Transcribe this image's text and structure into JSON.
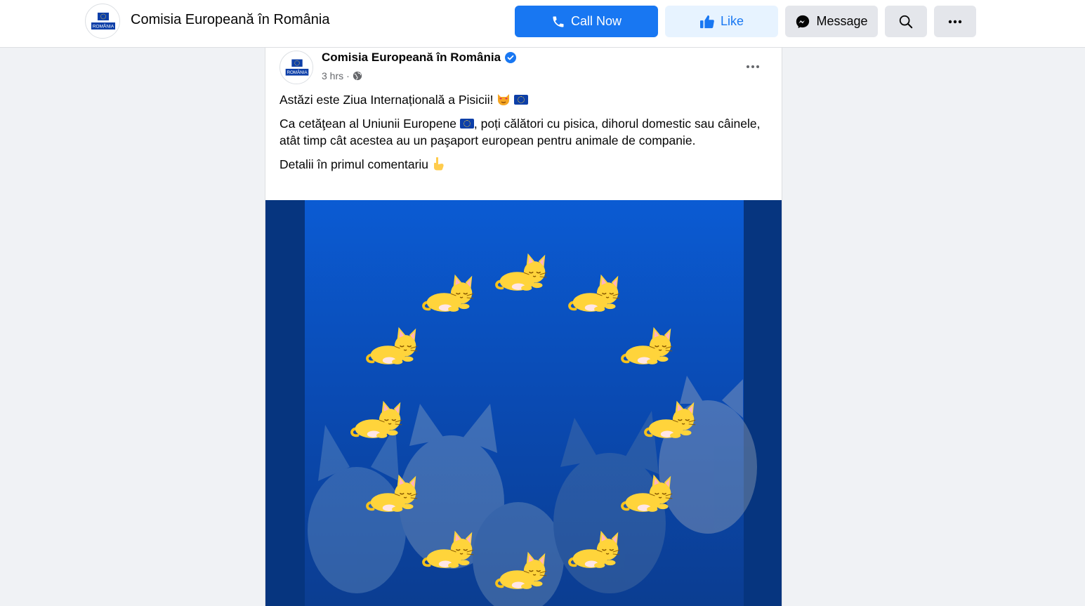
{
  "header": {
    "page_name": "Comisia Europeană în România",
    "avatar_label": "ROMÂNIA",
    "call_label": "Call Now",
    "like_label": "Like",
    "message_label": "Message"
  },
  "post": {
    "author": "Comisia Europeană în România",
    "time": "3 hrs",
    "line1": "Astăzi este Ziua Internațională a Pisicii!",
    "line2a": "Ca cetăţean al Uniunii Europene",
    "line2b": ", poți călători cu pisica, dihorul domestic sau câinele, atât timp cât acestea au un paşaport european pentru animale de companie.",
    "line3": "Detalii în primul comentariu"
  },
  "colors": {
    "primary": "#1877f2",
    "image_blue": "#0a4cc4",
    "star_yellow": "#ffd43b"
  },
  "icons": [
    "phone-icon",
    "like-icon",
    "messenger-icon",
    "search-icon",
    "more-icon",
    "verified-icon",
    "globe-icon",
    "cat-emoji-icon",
    "eu-flag-icon",
    "pointing-down-icon"
  ]
}
